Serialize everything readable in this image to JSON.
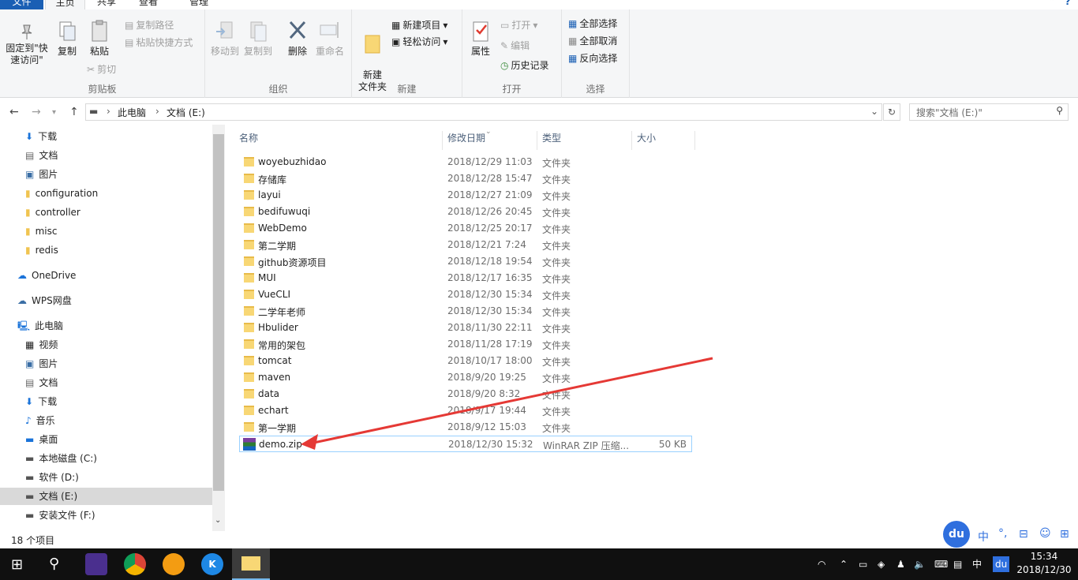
{
  "tabs": {
    "file": "文件",
    "home": "主页",
    "share": "共享",
    "view": "查看",
    "manage": "管理"
  },
  "ribbon": {
    "clipboard": {
      "label": "剪贴板",
      "pin": "固定到\"快速访问\"",
      "copy": "复制",
      "paste": "粘贴",
      "copy_path": "复制路径",
      "paste_shortcut": "粘贴快捷方式",
      "cut": "剪切"
    },
    "organize": {
      "label": "组织",
      "move_to": "移动到",
      "copy_to": "复制到",
      "delete": "删除",
      "rename": "重命名"
    },
    "new": {
      "label": "新建",
      "new_folder": "新建\n文件夹",
      "new_item": "新建项目",
      "easy_access": "轻松访问"
    },
    "open": {
      "label": "打开",
      "properties": "属性",
      "open": "打开",
      "edit": "编辑",
      "history": "历史记录"
    },
    "select": {
      "label": "选择",
      "select_all": "全部选择",
      "select_none": "全部取消",
      "invert": "反向选择"
    }
  },
  "address": {
    "this_pc": "此电脑",
    "drive": "文档 (E:)",
    "search_placeholder": "搜索\"文档 (E:)\""
  },
  "sidebar": {
    "quick": [
      {
        "label": "下载",
        "pinned": true
      },
      {
        "label": "文档",
        "pinned": true
      },
      {
        "label": "图片",
        "pinned": true
      },
      {
        "label": "configuration",
        "pinned": false
      },
      {
        "label": "controller",
        "pinned": false
      },
      {
        "label": "misc",
        "pinned": false
      },
      {
        "label": "redis",
        "pinned": false
      }
    ],
    "onedrive": "OneDrive",
    "wps": "WPS网盘",
    "this_pc": "此电脑",
    "pc_items": [
      "视频",
      "图片",
      "文档",
      "下载",
      "音乐",
      "桌面",
      "本地磁盘 (C:)",
      "软件 (D:)",
      "文档 (E:)",
      "安装文件 (F:)"
    ]
  },
  "columns": {
    "name": "名称",
    "date": "修改日期",
    "type": "类型",
    "size": "大小"
  },
  "files": [
    {
      "name": "woyebuzhidao",
      "date": "2018/12/29 11:03",
      "type": "文件夹",
      "size": ""
    },
    {
      "name": "存储库",
      "date": "2018/12/28 15:47",
      "type": "文件夹",
      "size": ""
    },
    {
      "name": "layui",
      "date": "2018/12/27 21:09",
      "type": "文件夹",
      "size": ""
    },
    {
      "name": "bedifuwuqi",
      "date": "2018/12/26 20:45",
      "type": "文件夹",
      "size": ""
    },
    {
      "name": "WebDemo",
      "date": "2018/12/25 20:17",
      "type": "文件夹",
      "size": ""
    },
    {
      "name": "第二学期",
      "date": "2018/12/21 7:24",
      "type": "文件夹",
      "size": ""
    },
    {
      "name": "github资源项目",
      "date": "2018/12/18 19:54",
      "type": "文件夹",
      "size": ""
    },
    {
      "name": "MUI",
      "date": "2018/12/17 16:35",
      "type": "文件夹",
      "size": ""
    },
    {
      "name": "VueCLI",
      "date": "2018/12/30 15:34",
      "type": "文件夹",
      "size": ""
    },
    {
      "name": "二学年老师",
      "date": "2018/12/30 15:34",
      "type": "文件夹",
      "size": ""
    },
    {
      "name": "Hbulider",
      "date": "2018/11/30 22:11",
      "type": "文件夹",
      "size": ""
    },
    {
      "name": "常用的架包",
      "date": "2018/11/28 17:19",
      "type": "文件夹",
      "size": ""
    },
    {
      "name": "tomcat",
      "date": "2018/10/17 18:00",
      "type": "文件夹",
      "size": ""
    },
    {
      "name": "maven",
      "date": "2018/9/20 19:25",
      "type": "文件夹",
      "size": ""
    },
    {
      "name": "data",
      "date": "2018/9/20 8:32",
      "type": "文件夹",
      "size": ""
    },
    {
      "name": "echart",
      "date": "2018/9/17 19:44",
      "type": "文件夹",
      "size": ""
    },
    {
      "name": "第一学期",
      "date": "2018/9/12 15:03",
      "type": "文件夹",
      "size": ""
    },
    {
      "name": "demo.zip",
      "date": "2018/12/30 15:32",
      "type": "WinRAR ZIP 压缩...",
      "size": "50 KB"
    }
  ],
  "status": "18 个项目",
  "ime": {
    "lang": "中",
    "punct": "°,"
  },
  "tray": {
    "lang": "中",
    "time": "15:34",
    "date": "2018/12/30"
  },
  "colors": {
    "accent": "#1a5fb4",
    "folder": "#f8d775",
    "arrow": "#e53935"
  }
}
